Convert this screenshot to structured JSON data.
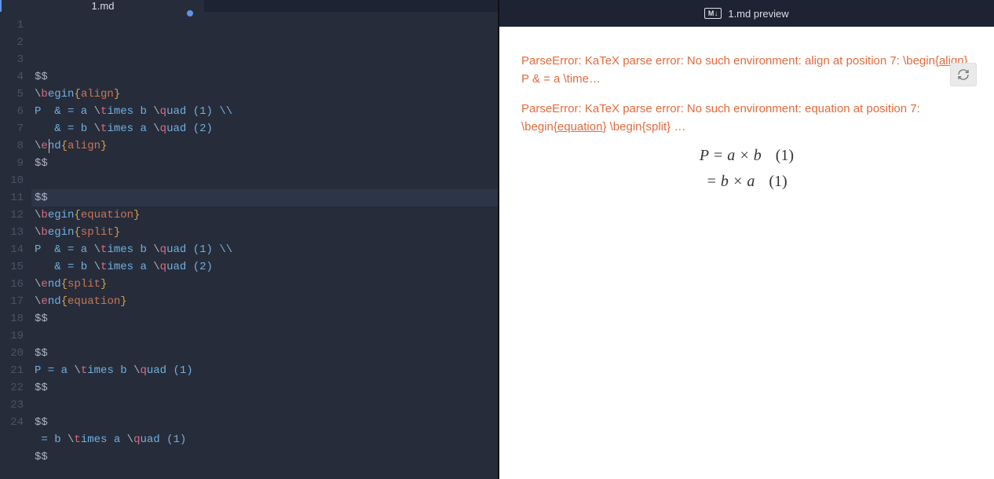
{
  "tabs": {
    "editor_title": "1.md",
    "preview_title": "1.md preview",
    "md_badge": "M↓",
    "dirty": true
  },
  "code_lines": [
    "$$",
    "\\begin{align}",
    "P  & = a \\times b \\quad (1) \\\\",
    "   & = b \\times a \\quad (2)",
    "\\end{align}",
    "$$",
    "",
    "$$",
    "\\begin{equation}",
    "\\begin{split}",
    "P  & = a \\times b \\quad (1) \\\\",
    "   & = b \\times a \\quad (2)",
    "\\end{split}",
    "\\end{equation}",
    "$$",
    "",
    "$$",
    "P = a \\times b \\quad (1)",
    "$$",
    "",
    "$$",
    " = b \\times a \\quad (1)",
    "$$",
    ""
  ],
  "current_line_index": 7,
  "preview": {
    "errors": [
      {
        "pre": "ParseError: KaTeX parse error: No such environment: align at position 7: \\begin",
        "u": "{align}",
        "post": " P & = a \\time…"
      },
      {
        "pre": "ParseError: KaTeX parse error: No such environment: equation at position 7: \\begin",
        "u": "{equation}",
        "post": " \\begin{split} …"
      }
    ],
    "math": [
      {
        "lhs": "P = ",
        "body": "a × b",
        "num": "(1)"
      },
      {
        "lhs": "= ",
        "body": "b × a",
        "num": "(1)"
      }
    ]
  }
}
